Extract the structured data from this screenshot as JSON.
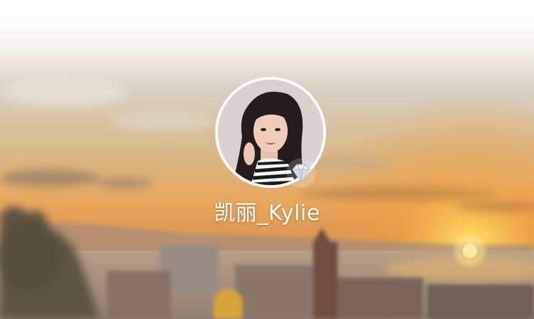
{
  "profile": {
    "username": "凯丽_Kylie",
    "avatar_icon": "user-avatar-photo",
    "badge_icon": "diamond-icon"
  },
  "colors": {
    "sky_top": "#ffffff",
    "sun": "#ffd35a",
    "text": "#ffffff"
  }
}
